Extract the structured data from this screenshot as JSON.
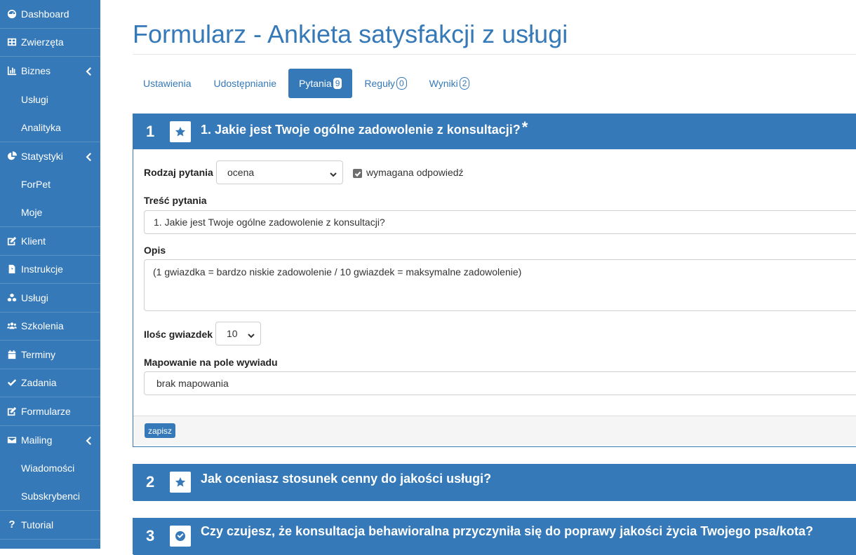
{
  "sidebar": {
    "items": [
      {
        "label": "Dashboard",
        "icon": "dashboard-icon"
      },
      {
        "label": "Zwierzęta",
        "icon": "table-icon"
      },
      {
        "label": "Biznes",
        "icon": "bar-chart-icon"
      },
      {
        "label": "Usługi"
      },
      {
        "label": "Analityka"
      },
      {
        "label": "Statystyki",
        "icon": "pie-chart-icon"
      },
      {
        "label": "ForPet"
      },
      {
        "label": "Moje"
      },
      {
        "label": "Klient",
        "icon": "edit-icon"
      },
      {
        "label": "Instrukcje",
        "icon": "pdf-file-icon"
      },
      {
        "label": "Usługi",
        "icon": "cubes-icon"
      },
      {
        "label": "Szkolenia",
        "icon": "users-icon"
      },
      {
        "label": "Terminy",
        "icon": "calendar-icon"
      },
      {
        "label": "Zadania",
        "icon": "check-icon"
      },
      {
        "label": "Formularze",
        "icon": "edit-icon"
      },
      {
        "label": "Mailing",
        "icon": "envelope-icon"
      },
      {
        "label": "Wiadomości"
      },
      {
        "label": "Subskrybenci"
      },
      {
        "label": "Tutorial",
        "icon": "question-icon"
      }
    ]
  },
  "page": {
    "title": "Formularz - Ankieta satysfakcji z usługi"
  },
  "tabs": [
    {
      "label": "Ustawienia"
    },
    {
      "label": "Udostępnianie"
    },
    {
      "label": "Pytania",
      "count": "9"
    },
    {
      "label": "Reguły",
      "count": "0"
    },
    {
      "label": "Wyniki",
      "count": "2"
    }
  ],
  "questions": [
    {
      "number": "1",
      "title": "1. Jakie jest Twoje ogólne zadowolenie z konsultacji?",
      "required_mark": "*",
      "icon": "star-icon",
      "form": {
        "type_label": "Rodzaj pytania",
        "type_value": "ocena",
        "required_label": "wymagana odpowiedź",
        "content_label": "Treść pytania",
        "content_value": "1. Jakie jest Twoje ogólne zadowolenie z konsultacji?",
        "desc_label": "Opis",
        "desc_value": "(1 gwiazdka = bardzo niskie zadowolenie / 10 gwiazdek = maksymalne zadowolenie)",
        "stars_label": "Ilośc gwiazdek",
        "stars_value": "10",
        "mapping_label": "Mapowanie na pole wywiadu",
        "mapping_value": "brak mapowania",
        "save_label": "zapisz"
      }
    },
    {
      "number": "2",
      "title": "Jak oceniasz stosunek cenny do jakości usługi?",
      "icon": "star-icon"
    },
    {
      "number": "3",
      "title": "Czy czujesz, że konsultacja behawioralna przyczyniła się do poprawy jakości życia Twojego psa/kota?",
      "icon": "check-circle-icon"
    }
  ],
  "colors": {
    "primary": "#3579b8"
  }
}
